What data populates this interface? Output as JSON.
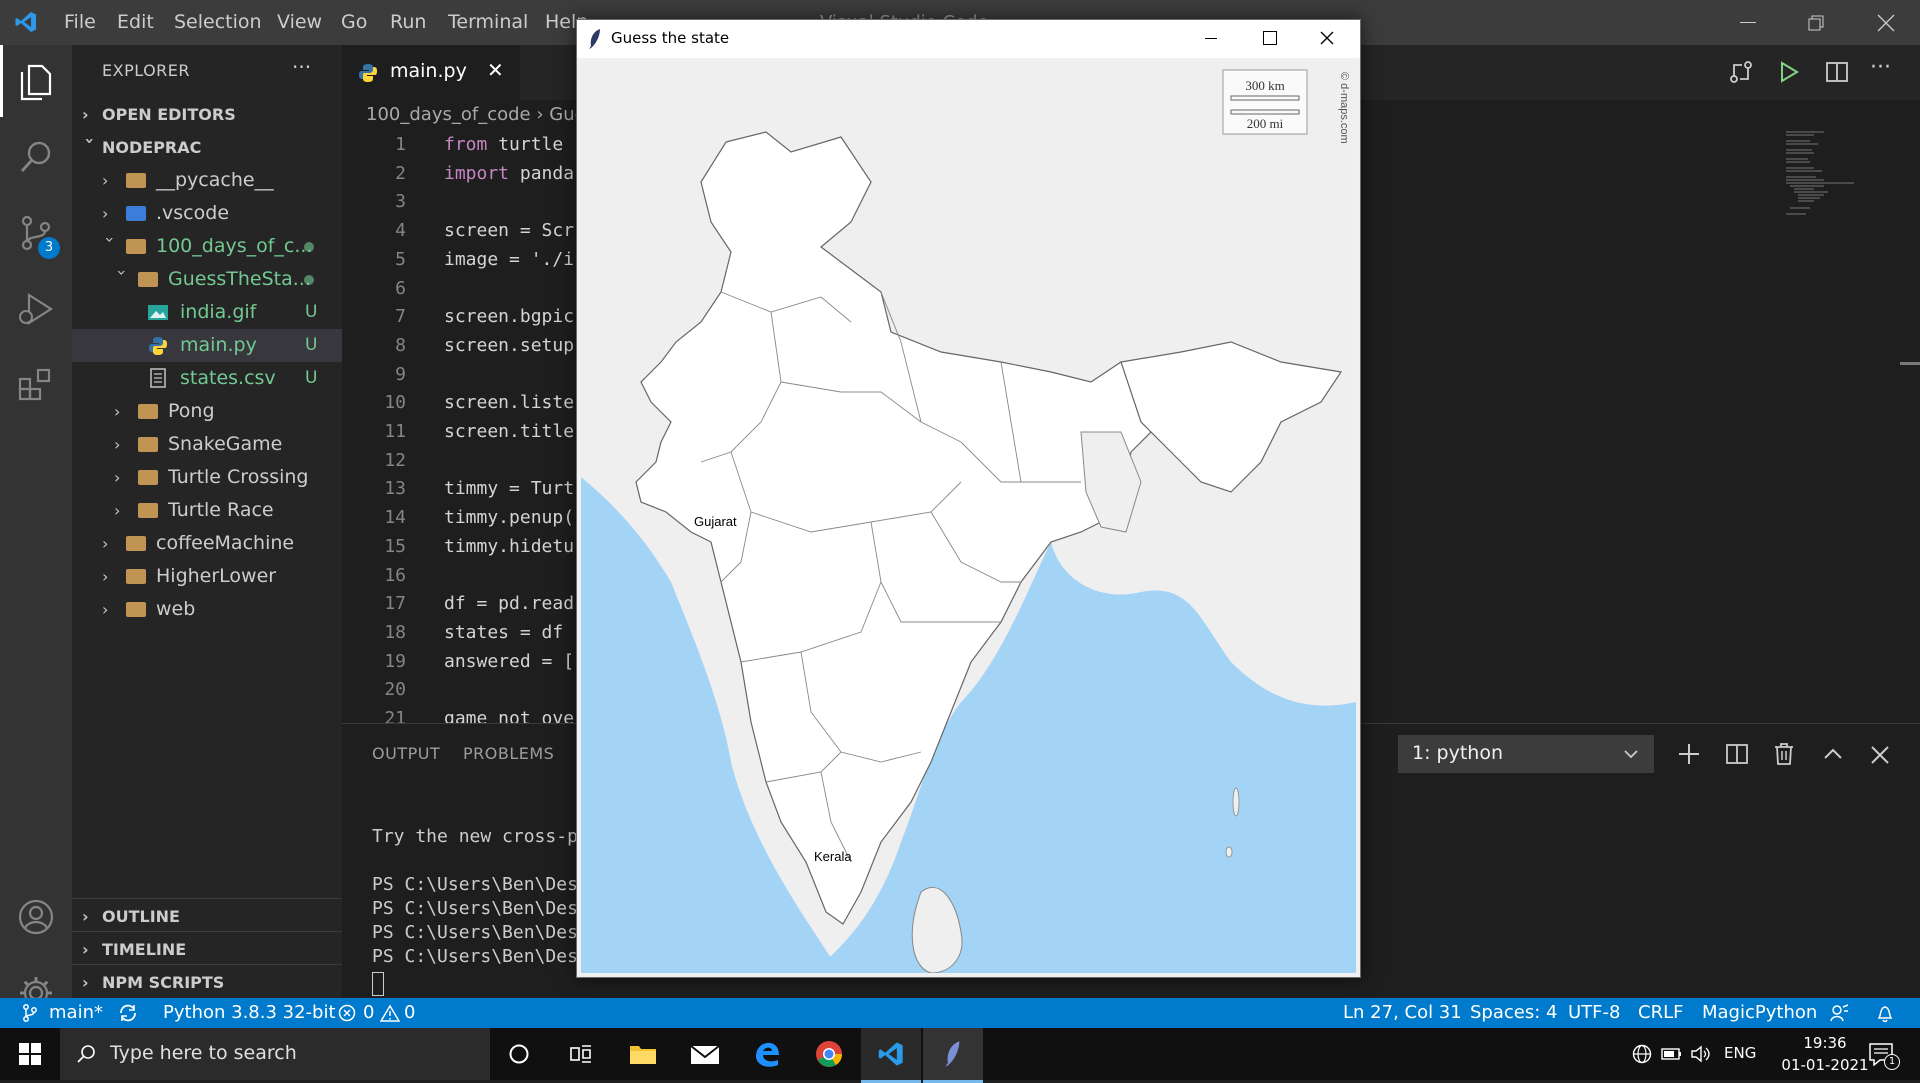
{
  "titlebar": {
    "menu": [
      "File",
      "Edit",
      "Selection",
      "View",
      "Go",
      "Run",
      "Terminal",
      "Help"
    ],
    "window_title": "Visual Studio Code"
  },
  "activity_bar": {
    "items": [
      "explorer-icon",
      "search-icon",
      "source-control-icon",
      "run-debug-icon",
      "extensions-icon"
    ],
    "scm_badge": "3",
    "bottom": [
      "account-icon",
      "settings-gear-icon"
    ]
  },
  "sidebar": {
    "header": "EXPLORER",
    "more": "···",
    "open_editors": "OPEN EDITORS",
    "workspace": "NODEPRAC",
    "tree": [
      {
        "label": "__pycache__",
        "level": 1,
        "type": "folder",
        "open": false
      },
      {
        "label": ".vscode",
        "level": 1,
        "type": "folder",
        "open": false
      },
      {
        "label": "100_days_of_c...",
        "level": 1,
        "type": "folder",
        "open": true
      },
      {
        "label": "GuessTheSta...",
        "level": 2,
        "type": "folder",
        "open": true
      },
      {
        "label": "india.gif",
        "level": 3,
        "type": "image",
        "status": "U"
      },
      {
        "label": "main.py",
        "level": 3,
        "type": "python",
        "status": "U"
      },
      {
        "label": "states.csv",
        "level": 3,
        "type": "csv",
        "status": "U"
      },
      {
        "label": "Pong",
        "level": 2,
        "type": "folder",
        "open": false
      },
      {
        "label": "SnakeGame",
        "level": 2,
        "type": "folder",
        "open": false
      },
      {
        "label": "Turtle Crossing",
        "level": 2,
        "type": "folder",
        "open": false
      },
      {
        "label": "Turtle Race",
        "level": 2,
        "type": "folder",
        "open": false
      },
      {
        "label": "coffeeMachine",
        "level": 1,
        "type": "folder",
        "open": false
      },
      {
        "label": "HigherLower",
        "level": 1,
        "type": "folder",
        "open": false
      },
      {
        "label": "web",
        "level": 1,
        "type": "folder",
        "open": false
      }
    ],
    "outline": "OUTLINE",
    "timeline": "TIMELINE",
    "npm_scripts": "NPM SCRIPTS"
  },
  "editor": {
    "tab_label": "main.py",
    "tab_close": "✕",
    "breadcrumb": [
      "100_days_of_code",
      "Gue"
    ],
    "lines": [
      {
        "n": "1",
        "kw": "from",
        "rest": " turtle"
      },
      {
        "n": "2",
        "kw": "import",
        "rest": " panda"
      },
      {
        "n": "3",
        "kw": "",
        "rest": ""
      },
      {
        "n": "4",
        "kw": "",
        "rest": "screen = Scr"
      },
      {
        "n": "5",
        "kw": "",
        "rest": "image = './i"
      },
      {
        "n": "6",
        "kw": "",
        "rest": ""
      },
      {
        "n": "7",
        "kw": "",
        "rest": "screen.bgpic"
      },
      {
        "n": "8",
        "kw": "",
        "rest": "screen.setup"
      },
      {
        "n": "9",
        "kw": "",
        "rest": ""
      },
      {
        "n": "10",
        "kw": "",
        "rest": "screen.liste"
      },
      {
        "n": "11",
        "kw": "",
        "rest": "screen.title"
      },
      {
        "n": "12",
        "kw": "",
        "rest": ""
      },
      {
        "n": "13",
        "kw": "",
        "rest": "timmy = Turt"
      },
      {
        "n": "14",
        "kw": "",
        "rest": "timmy.penup("
      },
      {
        "n": "15",
        "kw": "",
        "rest": "timmy.hidetu"
      },
      {
        "n": "16",
        "kw": "",
        "rest": ""
      },
      {
        "n": "17",
        "kw": "",
        "rest": "df = pd.read"
      },
      {
        "n": "18",
        "kw": "",
        "rest": "states = df"
      },
      {
        "n": "19",
        "kw": "",
        "rest": "answered = ["
      },
      {
        "n": "20",
        "kw": "",
        "rest": ""
      },
      {
        "n": "21",
        "kw": "",
        "rest": "game_not_ove"
      }
    ]
  },
  "panel": {
    "tabs": [
      "OUTPUT",
      "PROBLEMS"
    ],
    "terminal_select": "1: python",
    "terminal_lines": [
      "Try the new cross-p",
      "",
      "PS C:\\Users\\Ben\\Des",
      "PS C:\\Users\\Ben\\Des",
      "PS C:\\Users\\Ben\\Des",
      "PS C:\\Users\\Ben\\Des"
    ]
  },
  "turtle_window": {
    "title": "Guess the state",
    "scale_km": "300 km",
    "scale_mi": "200 mi",
    "credit": "© d-maps.com",
    "labels": {
      "gujarat": "Gujarat",
      "kerala": "Kerala"
    }
  },
  "statusbar": {
    "branch": "main*",
    "interpreter": "Python 3.8.3 32-bit",
    "errors": "0",
    "warnings": "0",
    "position": "Ln 27, Col 31",
    "spaces": "Spaces: 4",
    "encoding": "UTF-8",
    "eol": "CRLF",
    "language": "MagicPython"
  },
  "taskbar": {
    "search_placeholder": "Type here to search",
    "lang": "ENG",
    "time": "19:36",
    "date": "01-01-2021",
    "notif_count": "1"
  },
  "colors": {
    "accent": "#007acc",
    "untracked": "#73c991",
    "sea": "#a3d3f5",
    "land": "#ffffff",
    "foreign_land": "#efefef"
  }
}
